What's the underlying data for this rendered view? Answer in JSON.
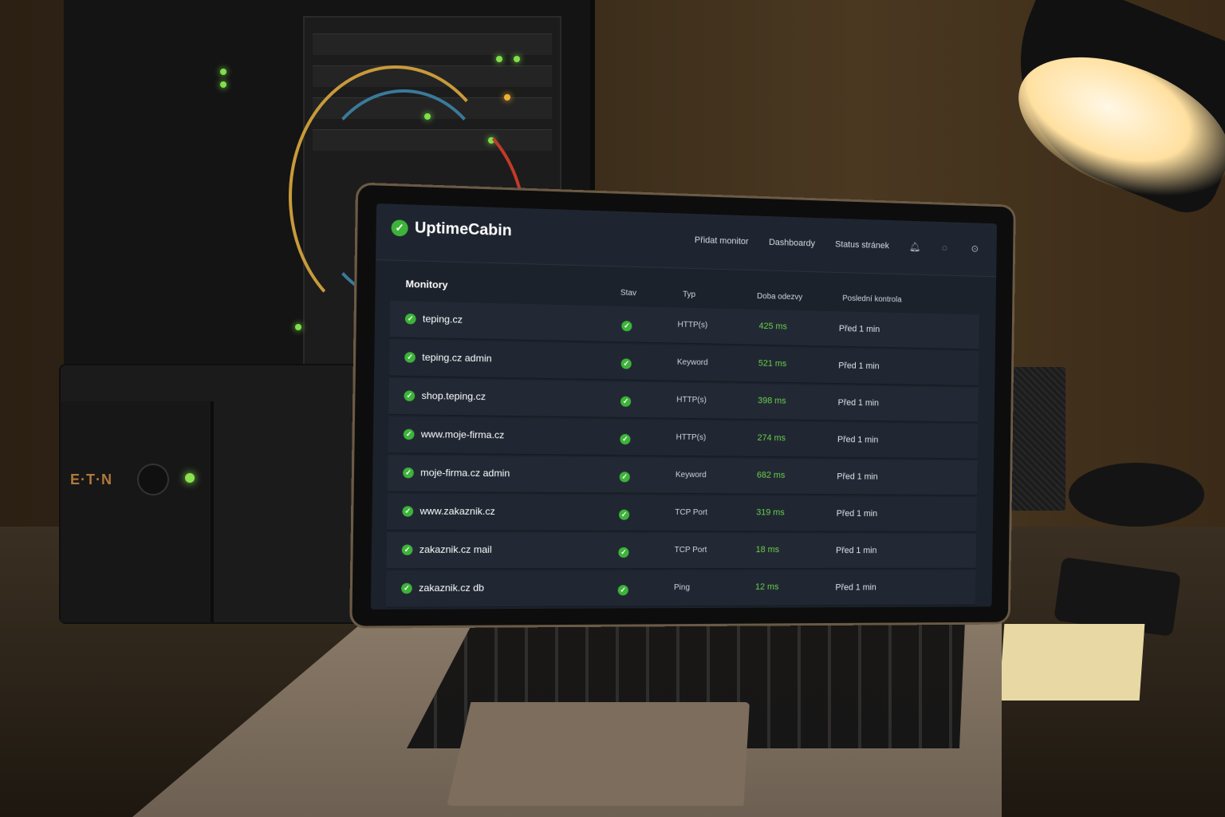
{
  "app": {
    "name": "UptimeCabin"
  },
  "nav": {
    "items": [
      "Přidat monitor",
      "Dashboardy",
      "Status stránek"
    ],
    "icons": [
      "bell-icon",
      "chat-icon",
      "user-icon"
    ]
  },
  "table": {
    "title": "Monitory",
    "columns": {
      "status": "Stav",
      "type": "Typ",
      "response": "Doba odezvy",
      "last_check": "Poslední kontrola"
    },
    "rows": [
      {
        "name": "teping.cz",
        "status": "up",
        "type": "HTTP(s)",
        "response": "425 ms",
        "last_check": "Před 1 min"
      },
      {
        "name": "teping.cz admin",
        "status": "up",
        "type": "Keyword",
        "response": "521 ms",
        "last_check": "Před 1 min"
      },
      {
        "name": "shop.teping.cz",
        "status": "up",
        "type": "HTTP(s)",
        "response": "398 ms",
        "last_check": "Před 1 min"
      },
      {
        "name": "www.moje-firma.cz",
        "status": "up",
        "type": "HTTP(s)",
        "response": "274 ms",
        "last_check": "Před 1 min"
      },
      {
        "name": "moje-firma.cz admin",
        "status": "up",
        "type": "Keyword",
        "response": "682 ms",
        "last_check": "Před 1 min"
      },
      {
        "name": "www.zakaznik.cz",
        "status": "up",
        "type": "TCP Port",
        "response": "319 ms",
        "last_check": "Před 1 min"
      },
      {
        "name": "zakaznik.cz mail",
        "status": "up",
        "type": "TCP Port",
        "response": "18 ms",
        "last_check": "Před 1 min"
      },
      {
        "name": "zakaznik.cz db",
        "status": "up",
        "type": "Ping",
        "response": "12 ms",
        "last_check": "Před 1 min"
      }
    ]
  },
  "ups": {
    "brand": "E·T·N"
  },
  "colors": {
    "accent": "#3db33a",
    "response_text": "#6cd04a",
    "screen_bg": "#1c222b"
  }
}
